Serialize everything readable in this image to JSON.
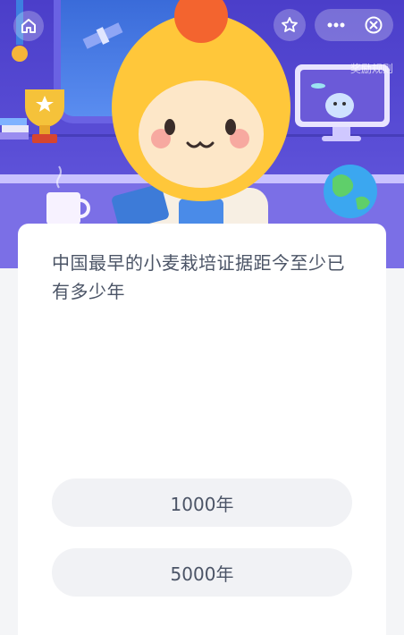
{
  "header": {
    "rules_link": "奖励规则",
    "home_icon": "home-icon",
    "star_icon": "star-icon",
    "more_icon": "more-icon",
    "close_icon": "close-icon"
  },
  "quiz": {
    "question": "中国最早的小麦栽培证据距今至少已有多少年",
    "options": [
      "1000年",
      "5000年"
    ]
  },
  "colors": {
    "hero_bg": "#5a4ed6",
    "card_bg": "#ffffff",
    "option_bg": "#f1f2f5",
    "text": "#4b5466"
  }
}
